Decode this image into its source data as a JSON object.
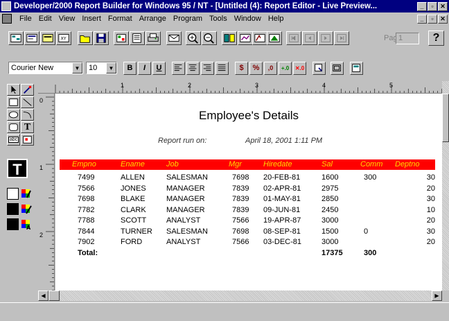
{
  "window": {
    "title": "Developer/2000 Report Builder for Windows 95 / NT - [Untitled (4): Report Editor - Live Preview..."
  },
  "menu": {
    "items": [
      "File",
      "Edit",
      "View",
      "Insert",
      "Format",
      "Arrange",
      "Program",
      "Tools",
      "Window",
      "Help"
    ]
  },
  "toolbar": {
    "page_label": "Page:",
    "page_value": "1",
    "help_label": "?"
  },
  "format_bar": {
    "font_family": "Courier New",
    "font_size": "10",
    "bold": "B",
    "italic": "I",
    "underline": "U"
  },
  "report": {
    "title": "Employee's Details",
    "run_label": "Report run on:",
    "run_date": "April 18, 2001 1:11 PM",
    "header_color": "#ff0000",
    "header_text_color": "#ffd700",
    "columns": [
      "Empno",
      "Ename",
      "Job",
      "Mgr",
      "Hiredate",
      "Sal",
      "Comm",
      "Deptno"
    ],
    "rows": [
      [
        "7499",
        "ALLEN",
        "SALESMAN",
        "7698",
        "20-FEB-81",
        "1600",
        "300",
        "30"
      ],
      [
        "7566",
        "JONES",
        "MANAGER",
        "7839",
        "02-APR-81",
        "2975",
        "",
        "20"
      ],
      [
        "7698",
        "BLAKE",
        "MANAGER",
        "7839",
        "01-MAY-81",
        "2850",
        "",
        "30"
      ],
      [
        "7782",
        "CLARK",
        "MANAGER",
        "7839",
        "09-JUN-81",
        "2450",
        "",
        "10"
      ],
      [
        "7788",
        "SCOTT",
        "ANALYST",
        "7566",
        "19-APR-87",
        "3000",
        "",
        "20"
      ],
      [
        "7844",
        "TURNER",
        "SALESMAN",
        "7698",
        "08-SEP-81",
        "1500",
        "0",
        "30"
      ],
      [
        "7902",
        "FORD",
        "ANALYST",
        "7566",
        "03-DEC-81",
        "3000",
        "",
        "20"
      ]
    ],
    "total_label": "Total:",
    "total_sal": "17375",
    "total_comm": "300"
  },
  "ruler": {
    "h_marks": [
      "1",
      "2",
      "3",
      "4",
      "5"
    ],
    "v_marks": [
      "0",
      "1",
      "2"
    ]
  },
  "palette": {
    "text_tool_label": "T",
    "field_tool_label": "abc"
  }
}
